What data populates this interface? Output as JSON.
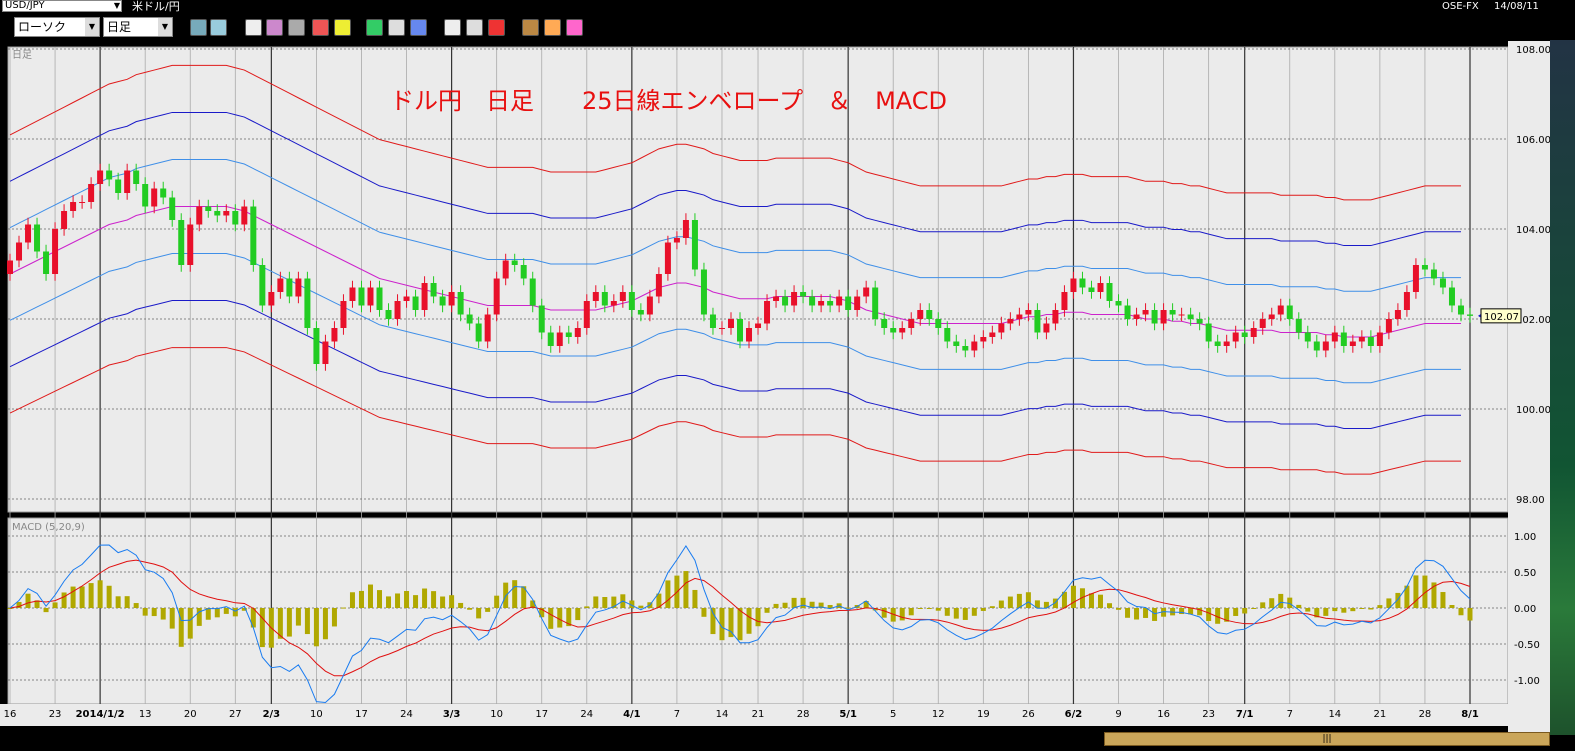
{
  "window": {
    "symbol": "USD/JPY",
    "symbol_name": "米ドル/円",
    "source": "OSE-FX",
    "date": "14/08/11"
  },
  "toolbar": {
    "chart_type": "ローソク",
    "timeframe": "日足",
    "buttons": [
      "search-icon",
      "crosshair-icon",
      "mark-icon",
      "zoom-icon",
      "grid-icon",
      "arrows-icon",
      "warning-icon",
      "pencil-icon",
      "cursor-icon",
      "move-icon",
      "candle-icon",
      "bar-icon",
      "all-icon",
      "gear-icon",
      "tool-icon",
      "color-icon"
    ]
  },
  "colors": {
    "bg": "#ebebeb",
    "up": "#e8102a",
    "down": "#22cc22",
    "ma": "#cc22cc",
    "env1": "#3f8fe8",
    "env2": "#1a1ac8",
    "env3": "#e01a1a",
    "macd": "#1a7cf0",
    "signal": "#e01010",
    "hist": "#b0a800"
  },
  "chart_data": {
    "type": "candlestick",
    "price_panel_label": "日足",
    "title": "ドル円　日足　　25日線エンベロープ　＆　MACD",
    "ylim": [
      98,
      108
    ],
    "yticks": [
      "108.00",
      "106.00",
      "104.00",
      "102.00",
      "100.00",
      "98.00"
    ],
    "last_price": "102.07",
    "xticks": [
      "16",
      "23",
      "2014/1/2",
      "13",
      "20",
      "27",
      "2/3",
      "10",
      "17",
      "24",
      "3/3",
      "10",
      "17",
      "24",
      "4/1",
      "7",
      "14",
      "21",
      "28",
      "5/1",
      "5",
      "12",
      "19",
      "26",
      "6/2",
      "9",
      "16",
      "23",
      "7/1",
      "7",
      "14",
      "21",
      "28",
      "8/1"
    ],
    "month_markers": [
      "2014/1/2",
      "2/3",
      "3/3",
      "4/1",
      "5/1",
      "6/2",
      "7/1",
      "8/1"
    ],
    "closes": [
      103.3,
      103.7,
      104.1,
      103.5,
      103.0,
      104.0,
      104.4,
      104.6,
      104.6,
      105.0,
      105.3,
      105.1,
      104.8,
      105.3,
      105.0,
      104.5,
      104.9,
      104.7,
      104.2,
      103.2,
      104.1,
      104.5,
      104.4,
      104.3,
      104.4,
      104.1,
      104.5,
      103.2,
      102.3,
      102.6,
      102.9,
      102.5,
      102.9,
      101.8,
      101.0,
      101.5,
      101.8,
      102.4,
      102.7,
      102.3,
      102.7,
      102.2,
      102.0,
      102.4,
      102.5,
      102.2,
      102.8,
      102.5,
      102.3,
      102.6,
      102.1,
      101.9,
      101.5,
      102.1,
      102.9,
      103.3,
      103.2,
      102.9,
      102.3,
      101.7,
      101.4,
      101.7,
      101.6,
      101.8,
      102.4,
      102.6,
      102.3,
      102.4,
      102.6,
      102.2,
      102.1,
      102.5,
      103.0,
      103.7,
      103.8,
      104.2,
      103.1,
      102.1,
      101.8,
      101.8,
      102.0,
      101.5,
      101.8,
      101.9,
      102.4,
      102.5,
      102.3,
      102.6,
      102.5,
      102.3,
      102.4,
      102.3,
      102.5,
      102.2,
      102.5,
      102.7,
      102.0,
      101.8,
      101.7,
      101.8,
      102.0,
      102.2,
      102.0,
      101.8,
      101.5,
      101.4,
      101.3,
      101.5,
      101.6,
      101.7,
      101.9,
      102.0,
      102.1,
      102.2,
      101.7,
      101.9,
      102.2,
      102.6,
      102.9,
      102.7,
      102.6,
      102.8,
      102.4,
      102.3,
      102.0,
      102.1,
      102.2,
      101.9,
      102.2,
      102.1,
      102.1,
      102.0,
      101.9,
      101.5,
      101.4,
      101.5,
      101.7,
      101.6,
      101.8,
      102.0,
      102.1,
      102.3,
      102.0,
      101.7,
      101.5,
      101.3,
      101.5,
      101.7,
      101.4,
      101.5,
      101.6,
      101.4,
      101.7,
      102.0,
      102.2,
      102.6,
      103.2,
      103.1,
      102.9,
      102.7,
      102.3,
      102.1,
      102.07
    ],
    "ma25": [
      103.0,
      103.1,
      103.2,
      103.3,
      103.4,
      103.5,
      103.6,
      103.7,
      103.8,
      103.9,
      104.0,
      104.1,
      104.15,
      104.2,
      104.3,
      104.35,
      104.4,
      104.45,
      104.5,
      104.5,
      104.5,
      104.5,
      104.5,
      104.5,
      104.5,
      104.45,
      104.4,
      104.3,
      104.2,
      104.1,
      104.0,
      103.9,
      103.8,
      103.7,
      103.6,
      103.5,
      103.4,
      103.3,
      103.2,
      103.1,
      103.0,
      102.9,
      102.85,
      102.8,
      102.75,
      102.7,
      102.65,
      102.6,
      102.55,
      102.5,
      102.45,
      102.4,
      102.35,
      102.3,
      102.3,
      102.3,
      102.3,
      102.3,
      102.3,
      102.25,
      102.2,
      102.2,
      102.2,
      102.2,
      102.2,
      102.2,
      102.25,
      102.3,
      102.35,
      102.4,
      102.5,
      102.6,
      102.7,
      102.75,
      102.8,
      102.8,
      102.75,
      102.7,
      102.6,
      102.55,
      102.5,
      102.45,
      102.45,
      102.45,
      102.45,
      102.5,
      102.5,
      102.5,
      102.5,
      102.5,
      102.5,
      102.5,
      102.45,
      102.4,
      102.3,
      102.2,
      102.15,
      102.1,
      102.05,
      102.0,
      101.95,
      101.9,
      101.9,
      101.9,
      101.9,
      101.9,
      101.9,
      101.9,
      101.9,
      101.9,
      101.9,
      101.95,
      102.0,
      102.05,
      102.05,
      102.1,
      102.1,
      102.15,
      102.15,
      102.15,
      102.1,
      102.1,
      102.1,
      102.1,
      102.1,
      102.05,
      102.0,
      102.0,
      102.0,
      101.95,
      101.95,
      101.9,
      101.9,
      101.85,
      101.8,
      101.75,
      101.75,
      101.75,
      101.75,
      101.75,
      101.75,
      101.7,
      101.7,
      101.7,
      101.7,
      101.7,
      101.65,
      101.65,
      101.6,
      101.6,
      101.6,
      101.6,
      101.65,
      101.7,
      101.75,
      101.8,
      101.85,
      101.9,
      101.9,
      101.9,
      101.9,
      101.9
    ],
    "envelope_pct": [
      1,
      2,
      3
    ],
    "macd": {
      "label": "MACD (5,20,9)",
      "ylim": [
        -1.25,
        1.25
      ],
      "yticks": [
        "1.00",
        "0.50",
        "0.00",
        "-0.50",
        "-1.00"
      ]
    }
  }
}
